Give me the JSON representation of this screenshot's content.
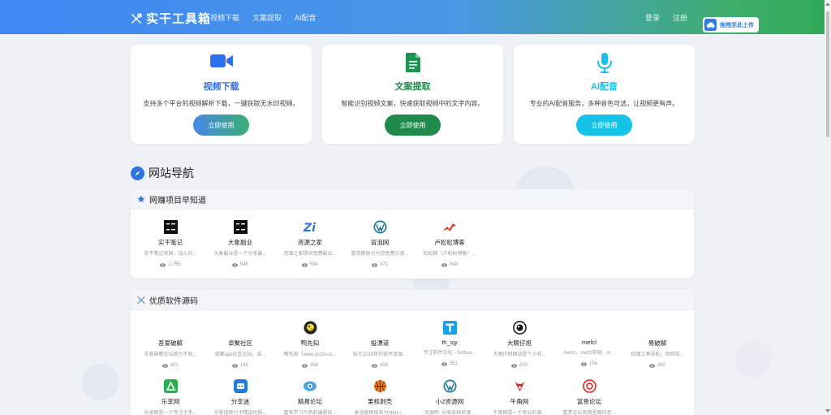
{
  "header": {
    "logo_text": "实干工具箱",
    "nav": [
      "视频下载",
      "文案提取",
      "AI配音"
    ],
    "login": "登录",
    "register": "注册",
    "upload_label": "拖拽至此上传"
  },
  "tools": [
    {
      "title": "视频下载",
      "desc": "支持多个平台的视频解析下载，一键获取无水印视频。",
      "button": "立即使用",
      "icon": "video-camera-icon",
      "color": "#2c6ff0"
    },
    {
      "title": "文案提取",
      "desc": "智能识别视频文案，快速获取视频中的文字内容。",
      "button": "立即使用",
      "icon": "document-icon",
      "color": "#1f8a4c"
    },
    {
      "title": "AI配音",
      "desc": "专业的AI配音服务，多种音色可选，让视频更有声。",
      "button": "立即使用",
      "icon": "microphone-icon",
      "color": "#13c2e6"
    }
  ],
  "nav_section_title": "网站导航",
  "sections": [
    {
      "title": "网赚项目早知道",
      "icon": "star-icon",
      "sites": [
        {
          "name": "实干笔记",
          "desc": "实干笔记官网，加入社...",
          "views": "1,755",
          "icon": "shigan-logo-icon"
        },
        {
          "name": "大象副业",
          "desc": "大象副业是一个分享副...",
          "views": "546",
          "icon": "daxiang-logo-icon"
        },
        {
          "name": "资源之家",
          "desc": "资源之家提供免费副业...",
          "views": "564",
          "icon": "zi-logo-icon"
        },
        {
          "name": "冒泡网",
          "desc": "冒泡网致力为您免费分享...",
          "views": "471",
          "icon": "wordpress-icon"
        },
        {
          "name": "卢松松博客",
          "desc": "松松网（卢松松博客）...",
          "views": "648",
          "icon": "bird-logo-icon"
        }
      ]
    },
    {
      "title": "优质软件源码",
      "icon": "tools-icon",
      "sites": [
        {
          "name": "吾爱破解",
          "desc": "吾爱破解论坛致力于软...",
          "views": "421",
          "icon": "none"
        },
        {
          "name": "卓聚社区",
          "desc": "卓聚app社区论坛，卓...",
          "views": "145",
          "icon": "none"
        },
        {
          "name": "鸭先知",
          "desc": "鸭先知（www.yxzhi.co...",
          "views": "354",
          "icon": "duck-logo-icon"
        },
        {
          "name": "投漂道",
          "desc": "始于2010年的软件资源...",
          "views": "459",
          "icon": "none"
        },
        {
          "name": "th_sjy",
          "desc": "专注软件汉化 - Softwa...",
          "views": "351",
          "icon": "t-logo-icon"
        },
        {
          "name": "大眼仔旭",
          "desc": "大眼仔旭网站是个人非...",
          "views": "430",
          "icon": "eye-logo-icon"
        },
        {
          "name": "mefcl",
          "desc": "mefcl，mefcl官网，m...",
          "views": "154",
          "icon": "none"
        },
        {
          "name": "易破解",
          "desc": "玫瑰工具导航，项目导...",
          "views": "382",
          "icon": "none"
        },
        {
          "name": "乐享网",
          "desc": "乐享网是一个专注于手...",
          "views": "",
          "icon": "lexiang-logo-icon"
        },
        {
          "name": "分享迷",
          "desc": "分享迷致力于精选优质...",
          "views": "",
          "icon": "fenxiangmi-logo-icon"
        },
        {
          "name": "精易论坛",
          "desc": "富有学习气氛的编程技...",
          "views": "",
          "icon": "jingyi-logo-icon"
        },
        {
          "name": "果核剥壳",
          "desc": "本站更换域名为https:/...",
          "views": "",
          "icon": "basketball-logo-icon"
        },
        {
          "name": "小Z资源网",
          "desc": "资源吧_分享各种资源...",
          "views": "",
          "icon": "wordpress-icon"
        },
        {
          "name": "牛角网",
          "desc": "牛角网是一个专业的源...",
          "views": "",
          "icon": "niujiao-logo-icon"
        },
        {
          "name": "富贵论坛",
          "desc": "富贵论坛官网里面内老...",
          "views": "",
          "icon": "fugui-logo-icon"
        }
      ]
    }
  ]
}
